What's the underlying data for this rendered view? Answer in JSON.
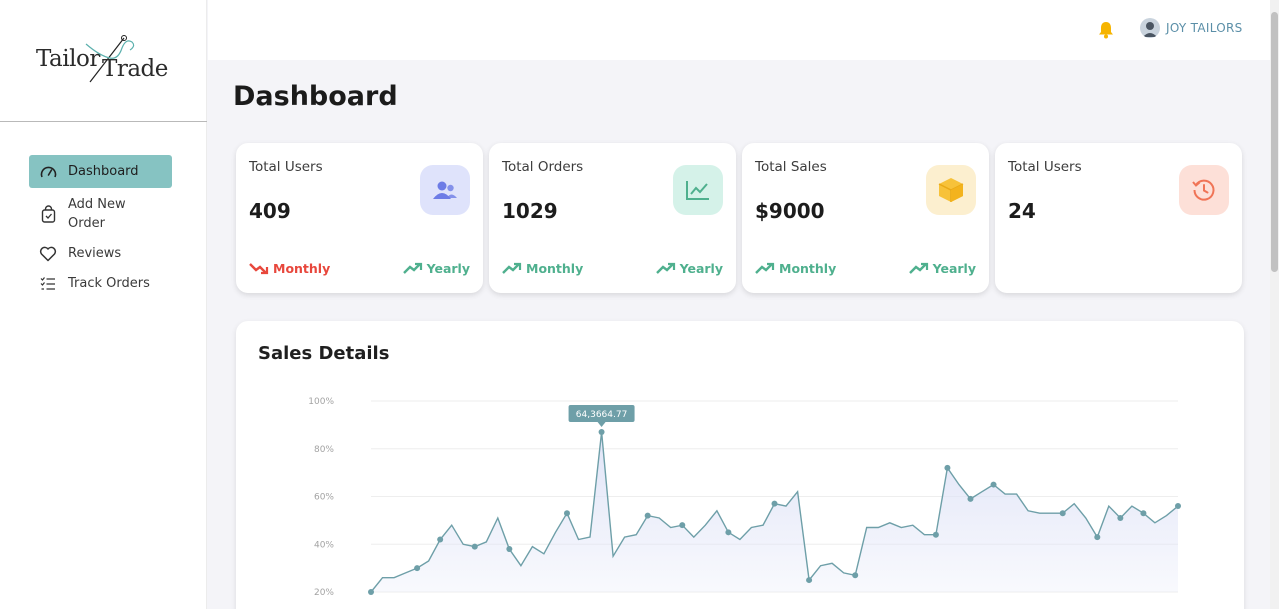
{
  "logo": {
    "part1": "Tailor",
    "part2": "Trade"
  },
  "sidebar": {
    "items": [
      {
        "label": "Dashboard",
        "icon": "gauge-icon"
      },
      {
        "label_line1": "Add New",
        "label_line2": "Order",
        "icon": "shopping-bag-icon"
      },
      {
        "label": "Reviews",
        "icon": "heart-icon"
      },
      {
        "label": "Track Orders",
        "icon": "checklist-icon"
      }
    ]
  },
  "header": {
    "user_name": "JOY TAILORS",
    "bell_icon": "bell-icon"
  },
  "page": {
    "title": "Dashboard"
  },
  "cards": [
    {
      "label": "Total Users",
      "value": "409",
      "icon": "users-icon",
      "icon_bg": "#dfe3fb",
      "monthly": "Monthly",
      "monthly_trend": "down",
      "yearly": "Yearly",
      "yearly_trend": "up"
    },
    {
      "label": "Total Orders",
      "value": "1029",
      "icon": "line-chart-icon",
      "icon_bg": "#d5f2e9",
      "monthly": "Monthly",
      "monthly_trend": "up",
      "yearly": "Yearly",
      "yearly_trend": "up"
    },
    {
      "label": "Total Sales",
      "value": "$9000",
      "icon": "box-icon",
      "icon_bg": "#fcefcf",
      "monthly": "Monthly",
      "monthly_trend": "up",
      "yearly": "Yearly",
      "yearly_trend": "up"
    },
    {
      "label": "Total Users",
      "value": "24",
      "icon": "history-icon",
      "icon_bg": "#fde0d8"
    }
  ],
  "colors": {
    "accent": "#86c3c2",
    "up": "#4fb08e",
    "down": "#e8473c",
    "line": "#6e9fa8",
    "fill": "#dfe3f7"
  },
  "sales": {
    "title": "Sales Details",
    "tooltip": "64,3664.77"
  },
  "chart_data": {
    "type": "area",
    "title": "Sales Details",
    "y_ticks": [
      "100%",
      "80%",
      "60%",
      "40%",
      "20%"
    ],
    "ylim": [
      20,
      100
    ],
    "grid": true,
    "values": [
      20,
      26,
      26,
      28,
      30,
      33,
      42,
      48,
      40,
      39,
      41,
      51,
      38,
      31,
      39,
      36,
      45,
      53,
      42,
      43,
      87,
      35,
      43,
      44,
      52,
      51,
      47,
      48,
      43,
      48,
      54,
      45,
      42,
      47,
      48,
      57,
      56,
      62,
      25,
      31,
      32,
      28,
      27,
      47,
      47,
      49,
      47,
      48,
      44,
      44,
      72,
      65,
      59,
      62,
      65,
      61,
      61,
      54,
      53,
      53,
      53,
      57,
      51,
      43,
      56,
      51,
      56,
      53,
      49,
      52,
      56
    ],
    "highlight_index": 20
  }
}
